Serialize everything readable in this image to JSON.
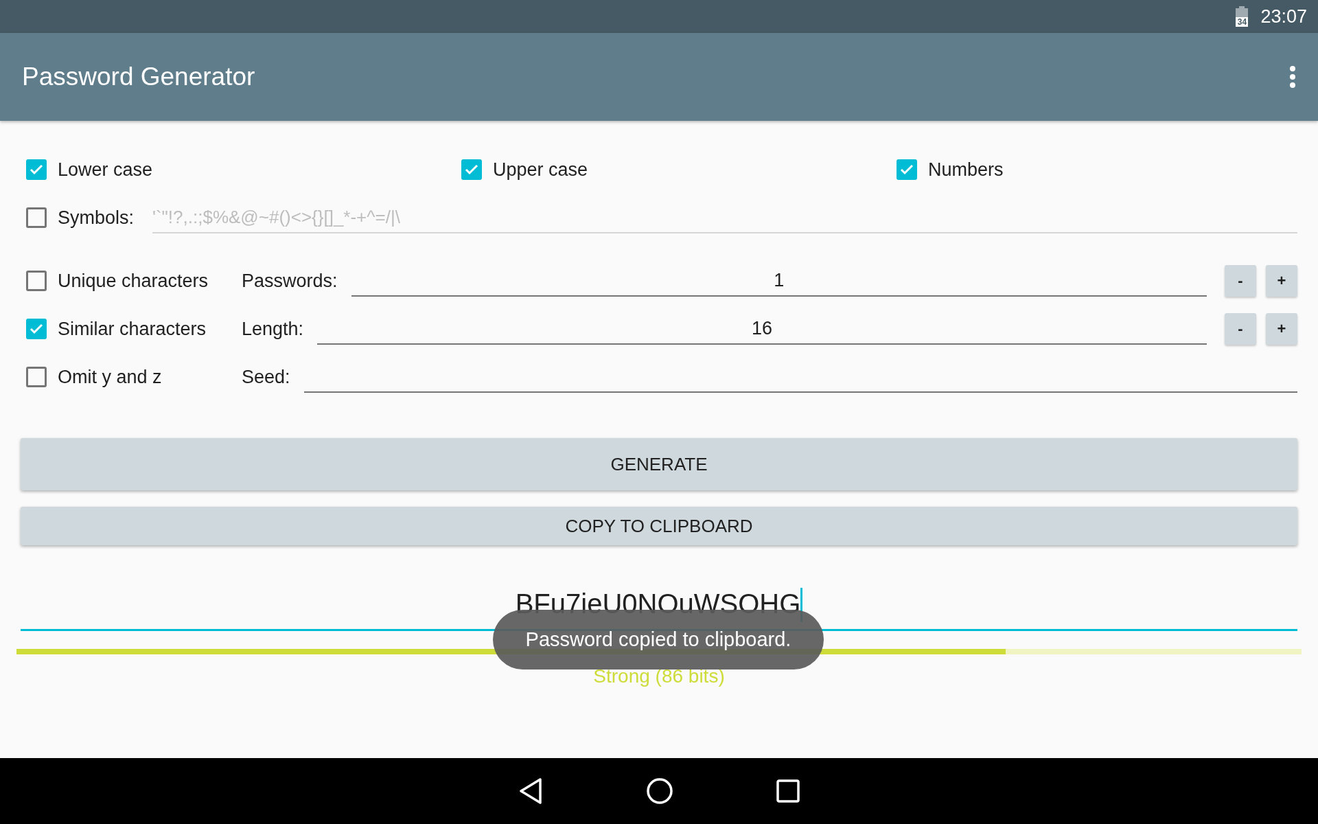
{
  "status_bar": {
    "battery": "34",
    "time": "23:07"
  },
  "app_bar": {
    "title": "Password Generator"
  },
  "char_options": [
    {
      "label": "Lower case",
      "checked": true
    },
    {
      "label": "Upper case",
      "checked": true
    },
    {
      "label": "Numbers",
      "checked": true
    }
  ],
  "symbols": {
    "label": "Symbols:",
    "checked": false,
    "placeholder": "'`\"!?,.:;$%&@~#()<>{}[]_*-+^=/|\\"
  },
  "settings": [
    {
      "option": {
        "label": "Unique characters",
        "checked": false
      },
      "field": {
        "label": "Passwords:",
        "value": "1",
        "stepper": [
          "-",
          "+"
        ]
      }
    },
    {
      "option": {
        "label": "Similar characters",
        "checked": true
      },
      "field": {
        "label": "Length:",
        "value": "16",
        "stepper": [
          "-",
          "+"
        ]
      }
    },
    {
      "option": {
        "label": "Omit y and z",
        "checked": false
      },
      "field": {
        "label": "Seed:"
      }
    }
  ],
  "buttons": [
    "GENERATE",
    "COPY TO CLIPBOARD"
  ],
  "password": {
    "value": "BFu7ieU0NOuWSOHG",
    "focused": true
  },
  "strength": {
    "level": 0.77,
    "label": "Strong (86 bits)"
  },
  "toast": {
    "text": "Password copied to clipboard."
  }
}
